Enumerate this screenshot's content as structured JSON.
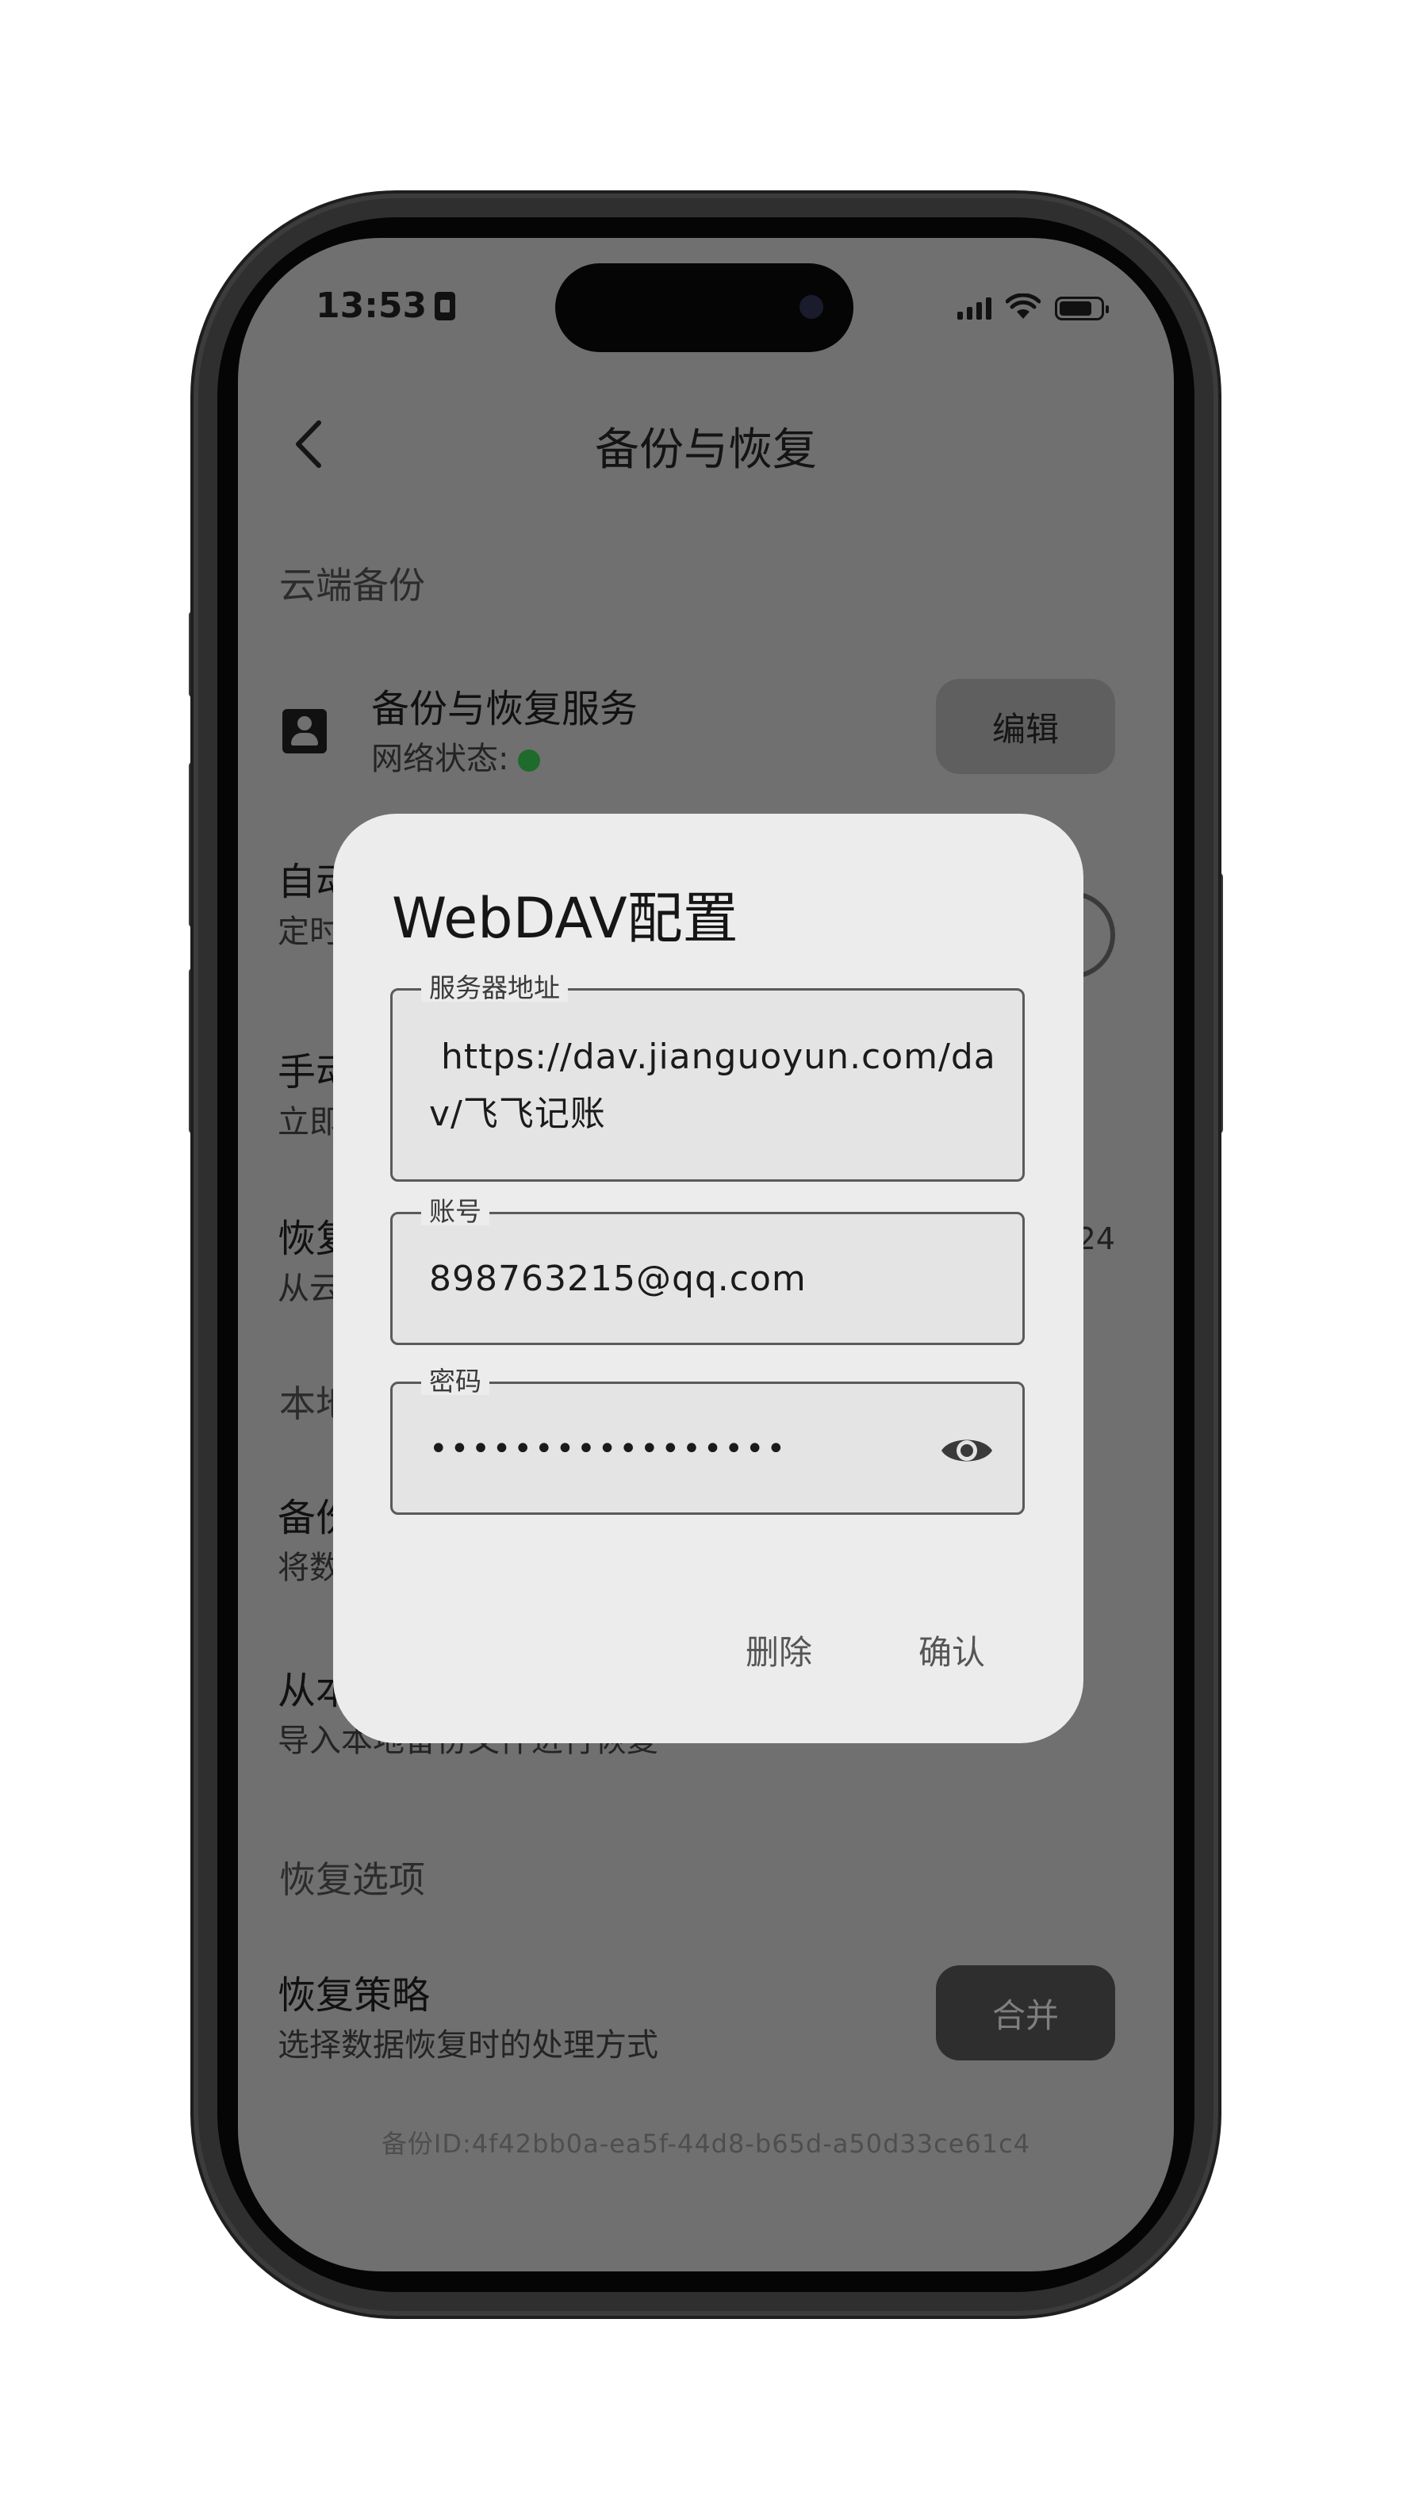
{
  "status_bar": {
    "time": "13:53"
  },
  "header": {
    "title": "备份与恢复"
  },
  "sections": {
    "cloud": "云端备份",
    "local_partial": "本地",
    "restore_options": "恢复选项"
  },
  "rows": {
    "service_title": "备份与恢复服务",
    "service_status_label": "网络状态:",
    "service_edit_label": "编辑",
    "auto_title_partial": "自动",
    "auto_sub_partial": "定时",
    "manual_title_partial": "手动",
    "manual_sub_partial": "立即",
    "restore_title_partial": "恢复",
    "restore_sub_partial": "从云",
    "restore_right_partial": "24",
    "backup_local_title_partial": "备份",
    "backup_local_sub_partial": "将数",
    "from_local_title_partial": "从本",
    "from_local_sub": "导入本地备份文件进行恢复",
    "strategy_title": "恢复策略",
    "strategy_sub": "选择数据恢复时的处理方式",
    "strategy_value": "合并"
  },
  "footer": {
    "backup_id": "备份ID:4f42bb0a-ea5f-44d8-b65d-a50d33ce61c4"
  },
  "dialog": {
    "title": "WebDAV配置",
    "server_label": "服务器地址",
    "server_value": " https://dav.jianguoyun.com/dav/飞飞记账",
    "account_label": "账号",
    "account_value": "898763215@qq.com",
    "password_label": "密码",
    "password_value": "•••••••••••••••••",
    "delete_label": "删除",
    "confirm_label": "确认"
  },
  "colors": {
    "scrim_background": "#707070",
    "dialog_background": "#ececec",
    "status_ok": "#1e6b2c"
  },
  "icons": [
    "back-arrow-icon",
    "account-box-icon",
    "eye-icon",
    "wifi-icon",
    "signal-icon",
    "battery-icon",
    "sim-icon"
  ]
}
